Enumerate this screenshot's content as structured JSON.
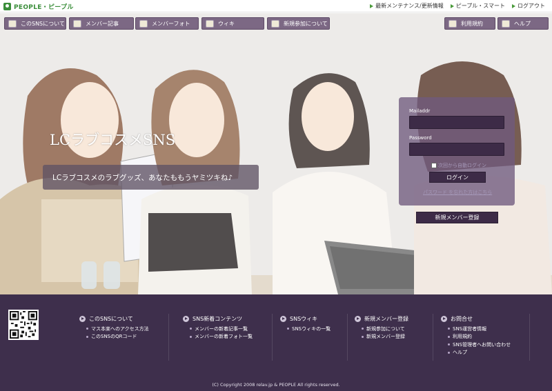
{
  "brand": {
    "name": "PEOPLE・ピープル"
  },
  "toplinks": [
    {
      "label": "最新メンテナンス/更新情報"
    },
    {
      "label": "ピープル・スマート"
    },
    {
      "label": "ログアウト"
    }
  ],
  "nav": {
    "left": [
      {
        "label": "このSNSについて",
        "icon": "person-icon"
      },
      {
        "label": "メンバー記事",
        "icon": "document-icon"
      },
      {
        "label": "メンバーフォト",
        "icon": "photo-icon"
      },
      {
        "label": "ウィキ",
        "icon": "globe-icon"
      },
      {
        "label": "新規参加について",
        "icon": "people-icon"
      }
    ],
    "right": [
      {
        "label": "利用規約",
        "icon": "pencil-icon"
      },
      {
        "label": "ヘルプ",
        "icon": "help-icon"
      }
    ]
  },
  "hero": {
    "title": "LCラブコスメSNS",
    "subtitle": "LCラブコスメのラブグッズ、あなたももうヤミツキね♪"
  },
  "login": {
    "mail_label": "Mailaddr",
    "mail_value": "",
    "password_label": "Password",
    "password_value": "",
    "remember_label": "次回から自動ログイン",
    "login_button": "ログイン",
    "forgot_link": "パスワード を忘れた方はこちら",
    "register_button": "新規メンバー登録"
  },
  "footer": {
    "columns": [
      {
        "heading": "このSNSについて",
        "items": [
          "マス本楽へのアクセス方法",
          "このSNSのQRコード"
        ]
      },
      {
        "heading": "SNS新着コンテンツ",
        "items": [
          "メンバーの新着記事一覧",
          "メンバーの新着フォト一覧"
        ]
      },
      {
        "heading": "SNSウィキ",
        "items": [
          "SNSウィキの一覧"
        ]
      },
      {
        "heading": "新規メンバー登録",
        "items": [
          "新規参加について",
          "新規メンバー登録"
        ]
      },
      {
        "heading": "お問合せ",
        "items": [
          "SNS運営者情報",
          "利用規約",
          "SNS管理者へお問い合わせ",
          "ヘルプ"
        ]
      }
    ],
    "copyright": "(C) Copyright 2008 relav.jp & PEOPLE All rights reserved."
  },
  "colors": {
    "accent": "#7c6884",
    "footer": "#3e2f4c",
    "brand": "#3b8e3b",
    "dark_button": "#3d2b47"
  }
}
